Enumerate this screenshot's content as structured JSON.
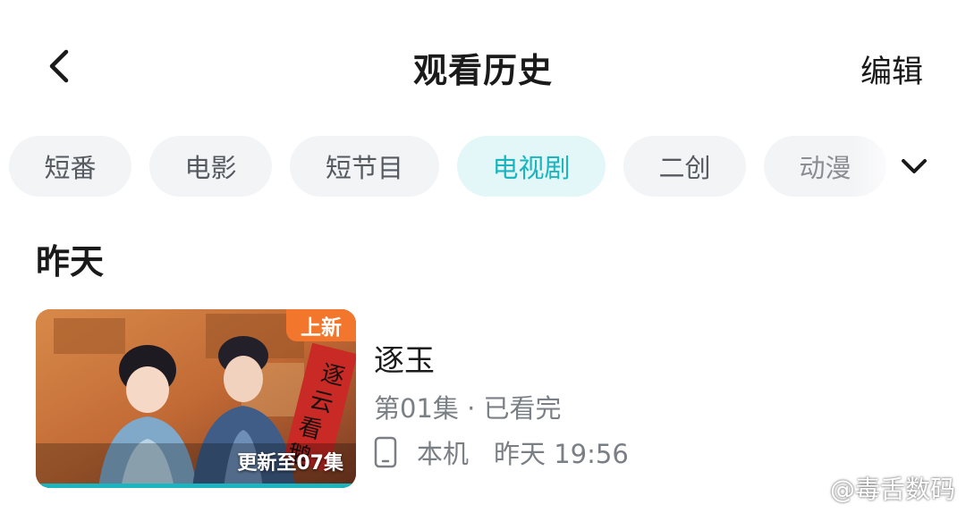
{
  "header": {
    "title": "观看历史",
    "edit_label": "编辑"
  },
  "tabs": [
    {
      "label": "短番",
      "active": false
    },
    {
      "label": "电影",
      "active": false
    },
    {
      "label": "短节目",
      "active": false
    },
    {
      "label": "电视剧",
      "active": true
    },
    {
      "label": "二创",
      "active": false
    },
    {
      "label": "动漫",
      "active": false
    }
  ],
  "section": {
    "title": "昨天"
  },
  "items": [
    {
      "title": "逐玉",
      "badge": "上新",
      "update_label": "更新至07集",
      "episode_status": "第01集 · 已看完",
      "device": "本机",
      "watched_time": "昨天 19:56"
    }
  ],
  "watermark": {
    "text": "@毒舌数码"
  },
  "colors": {
    "accent": "#1ab5bf",
    "accent_bg": "#e3f7f8",
    "badge": "#f2762b",
    "tab_bg": "#f3f4f6",
    "secondary_text": "#7a7f85"
  },
  "icons": {
    "back": "chevron-left-icon",
    "more": "chevron-down-icon",
    "device": "phone-icon",
    "watermark": "weibo-icon"
  }
}
